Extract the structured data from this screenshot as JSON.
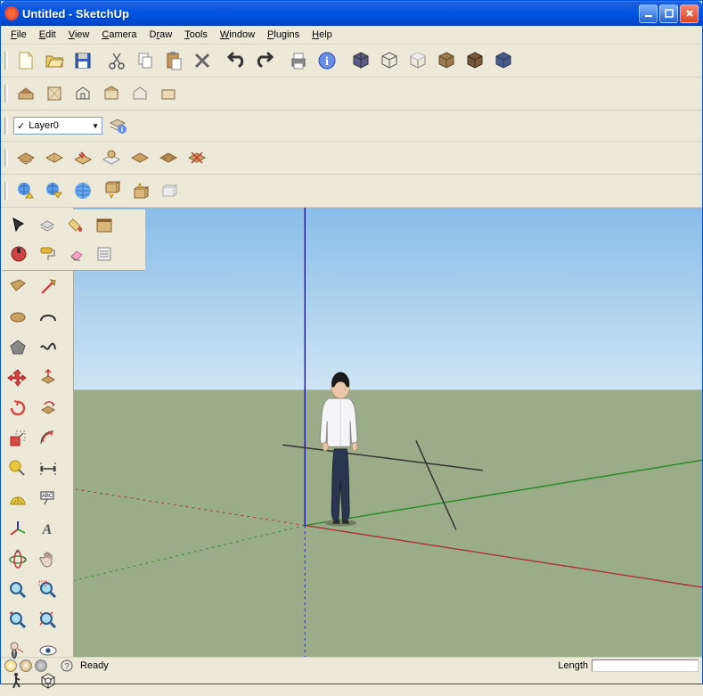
{
  "titlebar": {
    "text": "Untitled - SketchUp"
  },
  "menu": [
    "File",
    "Edit",
    "View",
    "Camera",
    "Draw",
    "Tools",
    "Window",
    "Plugins",
    "Help"
  ],
  "layer": {
    "current": "Layer0"
  },
  "toolbar1_icons": [
    "new-file",
    "open-file",
    "save-file",
    "cut",
    "copy",
    "paste",
    "delete",
    "undo",
    "redo",
    "print",
    "info",
    "cube-iso",
    "cube-front",
    "cube-side",
    "texture-1",
    "texture-2",
    "texture-3"
  ],
  "toolbar2_icons": [
    "house-1",
    "house-2",
    "house-3",
    "house-roof",
    "house-4",
    "house-5"
  ],
  "toolbar3_icons": [
    "surface-1",
    "surface-2",
    "surface-up",
    "surface-globe",
    "surface-flat",
    "surface-grid",
    "surface-x"
  ],
  "toolbar4_icons": [
    "earth-dl",
    "earth-up",
    "globe",
    "box-down",
    "box-up",
    "box-plain"
  ],
  "top_palette_icons": [
    "select",
    "paint-bucket",
    "hand-palette",
    "book",
    "camera-red",
    "paint-roll",
    "eraser-pink",
    "component",
    "",
    "",
    ""
  ],
  "side_tools": [
    "rectangle",
    "pencil",
    "circle",
    "arc",
    "triangle",
    "freehand",
    "move-red",
    "push-pull",
    "rotate-red",
    "follow-me",
    "scale-red",
    "offset",
    "tape",
    "axes-tool",
    "protractor",
    "text-label",
    "axes-3d",
    "text-3d",
    "dimension",
    "pan-hand",
    "zoom",
    "zoom-extents",
    "zoom-prev",
    "zoom-window",
    "walk",
    "look",
    "shadows",
    "section"
  ],
  "status": {
    "ready": "Ready",
    "length_label": "Length",
    "length_value": ""
  },
  "axes_colors": {
    "x": "#a33",
    "y": "#2a2",
    "z": "#22a"
  }
}
